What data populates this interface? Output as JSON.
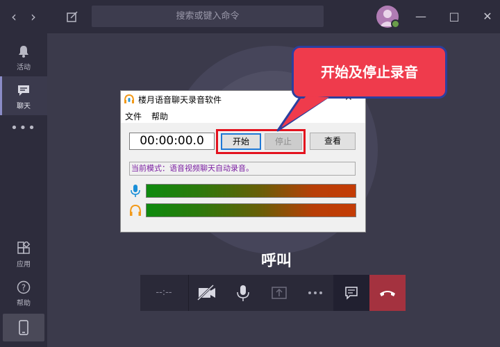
{
  "topbar": {
    "back_icon": "chevron-left-icon",
    "forward_icon": "chevron-right-icon",
    "search_placeholder": "搜索或键入命令"
  },
  "rail": {
    "items": [
      {
        "label": "活动",
        "icon": "bell-icon"
      },
      {
        "label": "聊天",
        "icon": "chat-icon"
      },
      {
        "label": "应用",
        "icon": "apps-icon"
      },
      {
        "label": "帮助",
        "icon": "help-icon"
      }
    ]
  },
  "call": {
    "caller": "呼叫",
    "timer": "--:--"
  },
  "recorder": {
    "title": "楼月语音聊天录音软件",
    "menu": [
      "文件",
      "帮助"
    ],
    "time": "00:00:00.0",
    "start_label": "开始",
    "stop_label": "停止",
    "view_label": "查看",
    "mode_text": "当前模式：语音视频聊天自动录音。"
  },
  "callout": {
    "text": "开始及停止录音"
  },
  "colors": {
    "accent": "#8b8cc7",
    "hangup": "#a4323f",
    "callout": "#ef3b4c",
    "callout_border": "#2b3f9e",
    "highlight": "#e3121e",
    "mode_text": "#7b1fa2"
  }
}
